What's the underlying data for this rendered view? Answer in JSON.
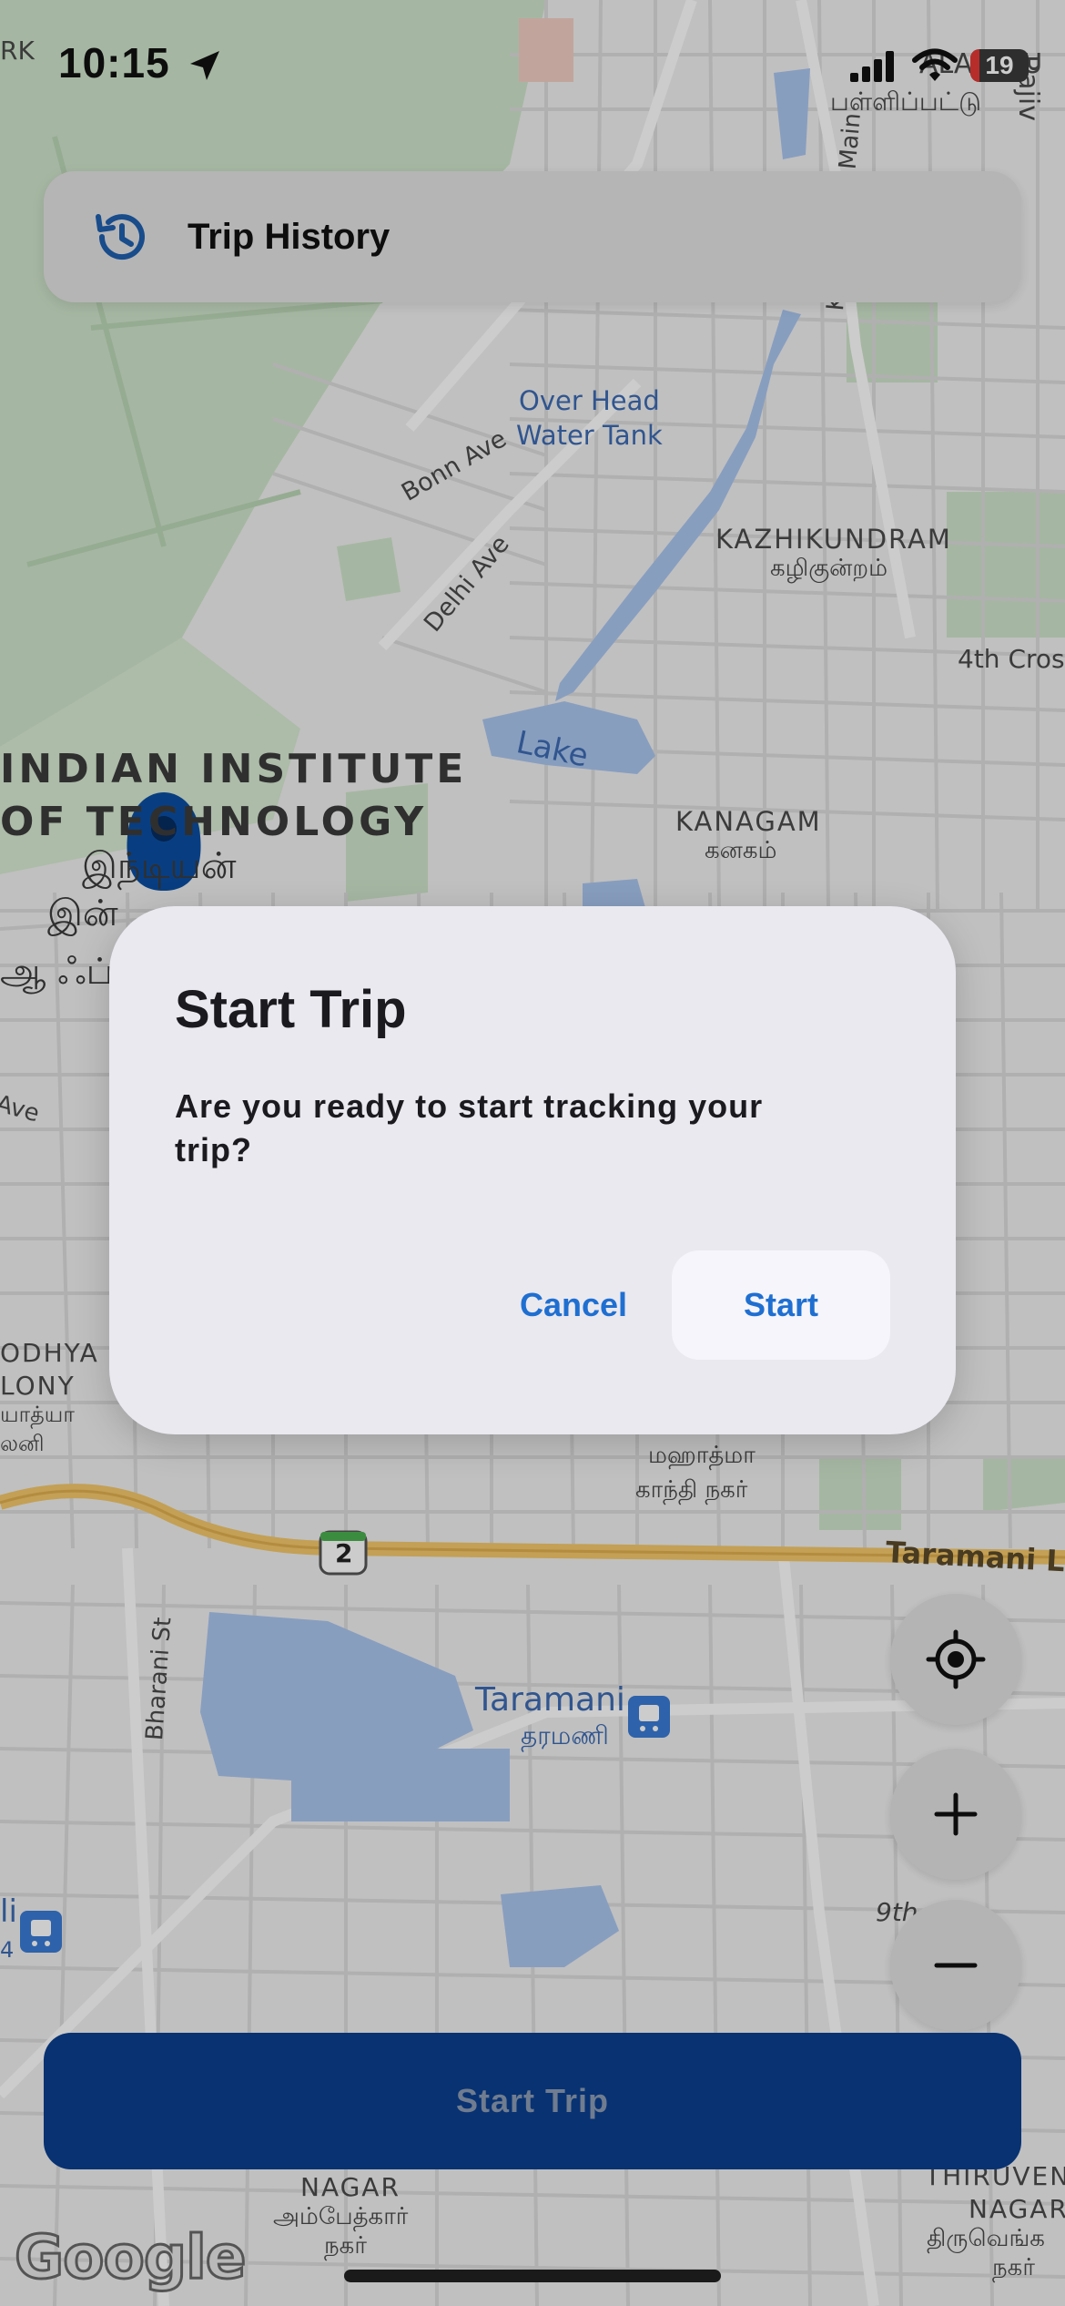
{
  "status_bar": {
    "time": "10:15",
    "battery": "19",
    "location_icon": "location-arrow-icon",
    "signal_icon": "cellular-signal-icon",
    "wifi_icon": "wifi-icon"
  },
  "trip_history": {
    "label": "Trip History",
    "icon": "history-clock-icon"
  },
  "map": {
    "labels": {
      "top_tamil": "பள்ளிப்பட்டு",
      "top_partial": "ALAPPAU",
      "water_tank_1": "Over Head",
      "water_tank_2": "Water Tank",
      "bonn_ave": "Bonn Ave",
      "delhi_ave": "Delhi Ave",
      "kalikunram": "KaliKunram Main",
      "kazhikundram": "KAZHIKUNDRAM",
      "kazhikundram_ta": "கழிகுன்றம்",
      "fourth_cross": "4th Cros",
      "lake": "Lake",
      "iit_1": "INDIAN INSTITUTE",
      "iit_2": "OF TECHNOLOGY",
      "iit_ta_1": "இந்டியன்",
      "iit_ta_2": "இன்",
      "iit_ta_3": "ஆ ஃப்",
      "kanagam": "KANAGAM",
      "kanagam_ta": "கனகம்",
      "ave": "Ave",
      "odhya": "ODHYA",
      "lony": "LONY",
      "odhya_ta": "யாத்யா",
      "lony_ta": "லனி",
      "gandhi_ta_1": "மஹாத்மா",
      "gandhi_ta_2": "காந்தி நகர்",
      "route_2": "2",
      "taramani_road": "Taramani Li",
      "bharani": "Bharani St",
      "taramani": "Taramani",
      "taramani_ta": "தரமணி",
      "ninth": "9th",
      "nagar": "NAGAR",
      "nagar_ta_1": "அம்பேத்கார்",
      "nagar_ta_2": "நகர்",
      "thiruveng_1": "THIRUVENG",
      "thiruveng_2": "NAGAR",
      "thiruveng_ta_1": "திருவெங்க",
      "thiruveng_ta_2": "நகர்",
      "top_right_partial": "Rajiv",
      "top_left_partial": "RK",
      "left_partial_1": "li",
      "left_partial_2": "4"
    },
    "google_logo": "Google"
  },
  "map_controls": {
    "locate_icon": "my-location-icon",
    "zoom_in_icon": "plus-icon",
    "zoom_out_icon": "minus-icon"
  },
  "start_trip_button": {
    "label": "Start Trip"
  },
  "dialog": {
    "title": "Start Trip",
    "message": "Are you ready to start tracking your trip?",
    "cancel_label": "Cancel",
    "start_label": "Start"
  },
  "colors": {
    "accent_blue": "#1f6fd1",
    "primary_button": "#0a3f8f",
    "map_water": "#aac6ef",
    "map_park": "#c9e3c4",
    "map_highway": "#f4c96b",
    "marker": "#0b4ea2"
  }
}
